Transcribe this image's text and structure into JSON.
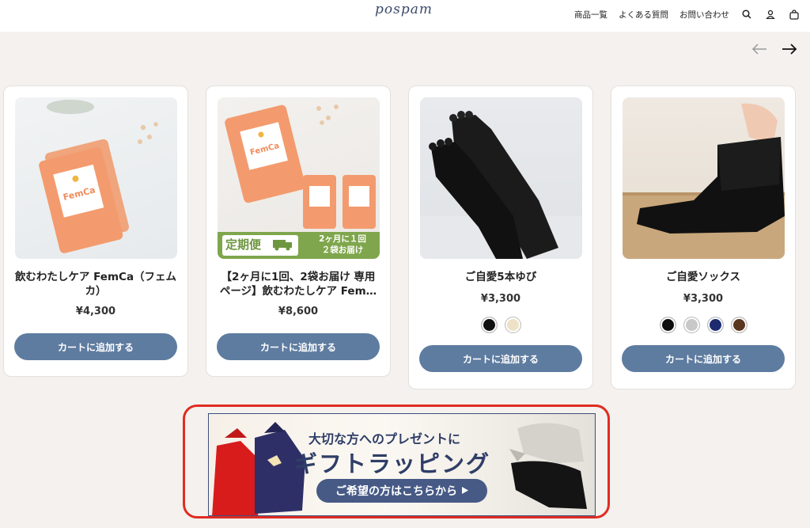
{
  "header": {
    "logo": "pospam",
    "nav": [
      "商品一覧",
      "よくある質問",
      "お問い合わせ"
    ]
  },
  "products": [
    {
      "title": "飲むわたしケア FemCa（フェムカ）",
      "price": "¥4,300",
      "button": "カートに追加する",
      "package_label": "FemCa"
    },
    {
      "title": "【2ヶ月に1回、2袋お届け 専用ページ】飲むわたしケア Fem…",
      "price": "¥8,600",
      "button": "カートに追加する",
      "package_label": "FemCa",
      "badge_left": "定期便",
      "badge_right_1": "2ヶ月に１回",
      "badge_right_2": "２袋お届け"
    },
    {
      "title": "ご自愛5本ゆび",
      "price": "¥3,300",
      "button": "カートに追加する",
      "swatches": [
        "#111111",
        "#ede2c6"
      ]
    },
    {
      "title": "ご自愛ソックス",
      "price": "¥3,300",
      "button": "カートに追加する",
      "swatches": [
        "#0d0d0d",
        "#c8c8c8",
        "#1d2c6e",
        "#5a3520"
      ]
    }
  ],
  "banner": {
    "line1": "大切な方へのプレゼントに",
    "line2": "ギフトラッピング",
    "cta": "ご希望の方はこちらから"
  },
  "colors": {
    "accent_button": "#5e7ca0",
    "banner_navy": "#2f3e67",
    "highlight_border": "#e02c22"
  }
}
